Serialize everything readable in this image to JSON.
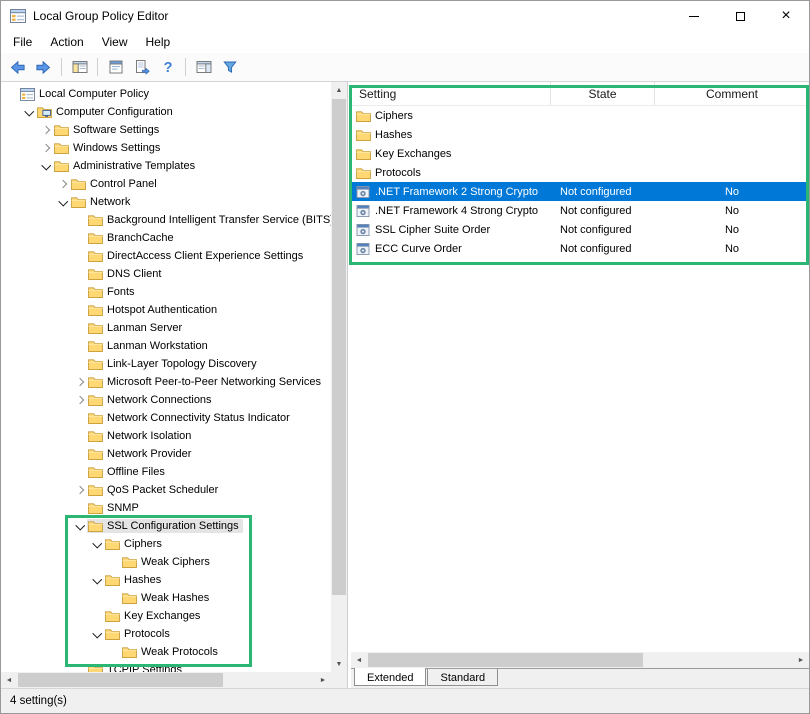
{
  "window": {
    "title": "Local Group Policy Editor"
  },
  "menu": {
    "items": [
      "File",
      "Action",
      "View",
      "Help"
    ]
  },
  "toolbar": {
    "buttons": [
      "back",
      "forward",
      "separator",
      "show-console-tree",
      "separator",
      "properties",
      "export-list",
      "help",
      "separator",
      "show-action-pane",
      "filter"
    ]
  },
  "colors": {
    "selection": "#0078d7",
    "selection_text": "#ffffff",
    "inactive_selection": "#e4e4e4",
    "annotation": "#2bb673"
  },
  "tree": {
    "items": [
      {
        "label": "Local Computer Policy",
        "level": 0,
        "chevron": "none",
        "icon": "console",
        "selected": false
      },
      {
        "label": "Computer Configuration",
        "level": 1,
        "chevron": "expanded",
        "icon": "computer",
        "selected": false
      },
      {
        "label": "Software Settings",
        "level": 2,
        "chevron": "collapsed",
        "icon": "folder",
        "selected": false
      },
      {
        "label": "Windows Settings",
        "level": 2,
        "chevron": "collapsed",
        "icon": "folder",
        "selected": false
      },
      {
        "label": "Administrative Templates",
        "level": 2,
        "chevron": "expanded",
        "icon": "folder",
        "selected": false
      },
      {
        "label": "Control Panel",
        "level": 3,
        "chevron": "collapsed",
        "icon": "folder",
        "selected": false
      },
      {
        "label": "Network",
        "level": 3,
        "chevron": "expanded",
        "icon": "folder",
        "selected": false
      },
      {
        "label": "Background Intelligent Transfer Service (BITS)",
        "level": 4,
        "chevron": "none",
        "icon": "folder",
        "selected": false
      },
      {
        "label": "BranchCache",
        "level": 4,
        "chevron": "none",
        "icon": "folder",
        "selected": false
      },
      {
        "label": "DirectAccess Client Experience Settings",
        "level": 4,
        "chevron": "none",
        "icon": "folder",
        "selected": false
      },
      {
        "label": "DNS Client",
        "level": 4,
        "chevron": "none",
        "icon": "folder",
        "selected": false
      },
      {
        "label": "Fonts",
        "level": 4,
        "chevron": "none",
        "icon": "folder",
        "selected": false
      },
      {
        "label": "Hotspot Authentication",
        "level": 4,
        "chevron": "none",
        "icon": "folder",
        "selected": false
      },
      {
        "label": "Lanman Server",
        "level": 4,
        "chevron": "none",
        "icon": "folder",
        "selected": false
      },
      {
        "label": "Lanman Workstation",
        "level": 4,
        "chevron": "none",
        "icon": "folder",
        "selected": false
      },
      {
        "label": "Link-Layer Topology Discovery",
        "level": 4,
        "chevron": "none",
        "icon": "folder",
        "selected": false
      },
      {
        "label": "Microsoft Peer-to-Peer Networking Services",
        "level": 4,
        "chevron": "collapsed",
        "icon": "folder",
        "selected": false
      },
      {
        "label": "Network Connections",
        "level": 4,
        "chevron": "collapsed",
        "icon": "folder",
        "selected": false
      },
      {
        "label": "Network Connectivity Status Indicator",
        "level": 4,
        "chevron": "none",
        "icon": "folder",
        "selected": false
      },
      {
        "label": "Network Isolation",
        "level": 4,
        "chevron": "none",
        "icon": "folder",
        "selected": false
      },
      {
        "label": "Network Provider",
        "level": 4,
        "chevron": "none",
        "icon": "folder",
        "selected": false
      },
      {
        "label": "Offline Files",
        "level": 4,
        "chevron": "none",
        "icon": "folder",
        "selected": false
      },
      {
        "label": "QoS Packet Scheduler",
        "level": 4,
        "chevron": "collapsed",
        "icon": "folder",
        "selected": false
      },
      {
        "label": "SNMP",
        "level": 4,
        "chevron": "none",
        "icon": "folder",
        "selected": false
      },
      {
        "label": "SSL Configuration Settings",
        "level": 4,
        "chevron": "expanded",
        "icon": "folder",
        "selected": true
      },
      {
        "label": "Ciphers",
        "level": 5,
        "chevron": "expanded",
        "icon": "folder",
        "selected": false
      },
      {
        "label": "Weak Ciphers",
        "level": 6,
        "chevron": "none",
        "icon": "folder",
        "selected": false
      },
      {
        "label": "Hashes",
        "level": 5,
        "chevron": "expanded",
        "icon": "folder",
        "selected": false
      },
      {
        "label": "Weak Hashes",
        "level": 6,
        "chevron": "none",
        "icon": "folder",
        "selected": false
      },
      {
        "label": "Key Exchanges",
        "level": 5,
        "chevron": "none",
        "icon": "folder",
        "selected": false
      },
      {
        "label": "Protocols",
        "level": 5,
        "chevron": "expanded",
        "icon": "folder",
        "selected": false
      },
      {
        "label": "Weak Protocols",
        "level": 6,
        "chevron": "none",
        "icon": "folder",
        "selected": false
      },
      {
        "label": "TCPIP Settings",
        "level": 4,
        "chevron": "none",
        "icon": "folder",
        "selected": false
      }
    ]
  },
  "list": {
    "columns": [
      "Setting",
      "State",
      "Comment"
    ],
    "rows": [
      {
        "setting": "Ciphers",
        "icon": "folder",
        "state": "",
        "comment": "",
        "selected": false
      },
      {
        "setting": "Hashes",
        "icon": "folder",
        "state": "",
        "comment": "",
        "selected": false
      },
      {
        "setting": "Key Exchanges",
        "icon": "folder",
        "state": "",
        "comment": "",
        "selected": false
      },
      {
        "setting": "Protocols",
        "icon": "folder",
        "state": "",
        "comment": "",
        "selected": false
      },
      {
        "setting": ".NET Framework 2 Strong Crypto",
        "icon": "setting",
        "state": "Not configured",
        "comment": "No",
        "selected": true
      },
      {
        "setting": ".NET Framework 4 Strong Crypto",
        "icon": "setting",
        "state": "Not configured",
        "comment": "No",
        "selected": false
      },
      {
        "setting": "SSL Cipher Suite Order",
        "icon": "setting",
        "state": "Not configured",
        "comment": "No",
        "selected": false
      },
      {
        "setting": "ECC Curve Order",
        "icon": "setting",
        "state": "Not configured",
        "comment": "No",
        "selected": false
      }
    ]
  },
  "tabs": {
    "items": [
      {
        "label": "Extended",
        "active": true
      },
      {
        "label": "Standard",
        "active": false
      }
    ]
  },
  "statusbar": {
    "text": "4 setting(s)"
  }
}
